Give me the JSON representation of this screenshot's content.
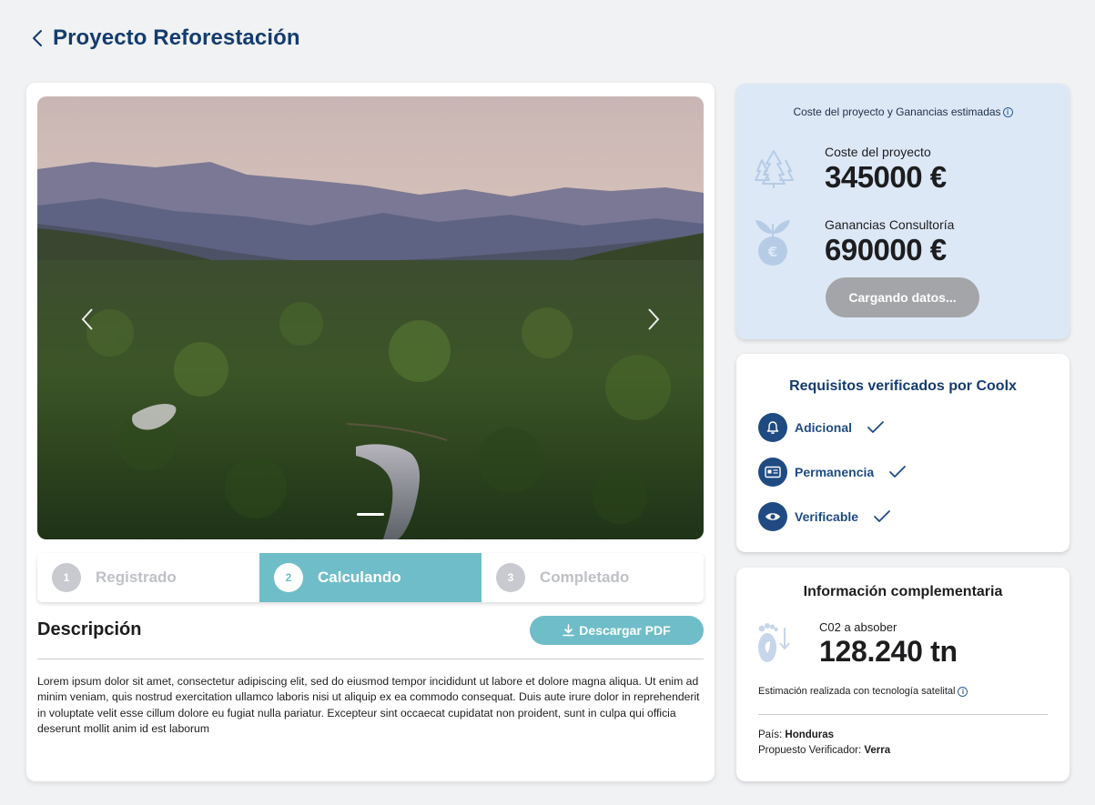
{
  "header": {
    "title": "Proyecto Reforestación"
  },
  "carousel": {
    "image_alt": "Vista aérea de bosque tropical con río y montañas"
  },
  "steps": [
    {
      "number": "1",
      "label": "Registrado",
      "state": "inactive"
    },
    {
      "number": "2",
      "label": "Calculando",
      "state": "active"
    },
    {
      "number": "3",
      "label": "Completado",
      "state": "inactive"
    }
  ],
  "description": {
    "title": "Descripción",
    "download_label": "Descargar PDF",
    "text": "Lorem ipsum dolor sit amet, consectetur adipiscing elit, sed do eiusmod tempor incididunt ut labore et dolore magna aliqua. Ut enim ad minim veniam, quis nostrud exercitation ullamco laboris nisi ut aliquip ex ea commodo consequat. Duis aute irure dolor in reprehenderit in voluptate velit esse cillum dolore eu fugiat nulla pariatur. Excepteur sint occaecat cupidatat non proident, sunt in culpa qui officia deserunt mollit anim id est laborum"
  },
  "cost": {
    "header": "Coste del proyecto y Ganancias estimadas",
    "project_cost_label": "Coste del proyecto",
    "project_cost_value": "345000 €",
    "earnings_label": "Ganancias Consultoría",
    "earnings_value": "690000 €",
    "loading_label": "Cargando datos..."
  },
  "requirements": {
    "title": "Requisitos verificados por Coolx",
    "items": [
      {
        "label": "Adicional",
        "icon": "bell-icon"
      },
      {
        "label": "Permanencia",
        "icon": "id-card-icon"
      },
      {
        "label": "Verificable",
        "icon": "eye-icon"
      }
    ]
  },
  "info": {
    "title": "Información complementaria",
    "co2_label": "C02 a absober",
    "co2_value": "128.240 tn",
    "estimation": "Estimación realizada con tecnología satelital",
    "country_label": "País: ",
    "country_value": "Honduras",
    "verifier_label": "Propuesto Verificador: ",
    "verifier_value": "Verra"
  },
  "colors": {
    "primary": "#143c6e",
    "accent": "#6fbdc8",
    "cost_bg": "#dde8f6",
    "disabled": "#a4a5a8"
  }
}
